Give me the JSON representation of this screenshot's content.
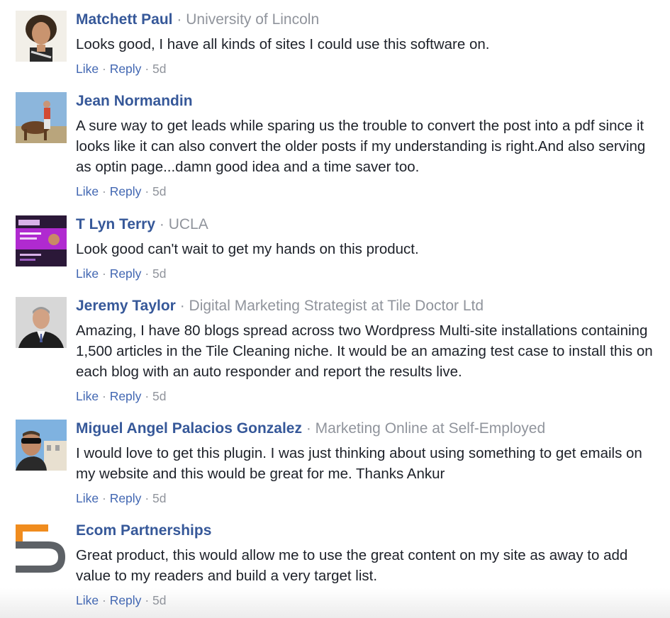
{
  "separator": "·",
  "comments": [
    {
      "author": "Matchett Paul",
      "affiliation": "University of Lincoln",
      "text": "Looks good, I have all kinds of sites I could use this software on.",
      "like": "Like",
      "reply": "Reply",
      "time": "5d"
    },
    {
      "author": "Jean Normandin",
      "affiliation": "",
      "text": "A sure way to get leads while sparing us the trouble to convert the post into a pdf since it looks like it can also convert the older posts if my understanding is right.And also serving as optin page...damn good idea and a time saver too.",
      "like": "Like",
      "reply": "Reply",
      "time": "5d"
    },
    {
      "author": "T Lyn Terry",
      "affiliation": "UCLA",
      "text": "Look good can't wait to get my hands on this product.",
      "like": "Like",
      "reply": "Reply",
      "time": "5d"
    },
    {
      "author": "Jeremy Taylor",
      "affiliation": "Digital Marketing Strategist at Tile Doctor Ltd",
      "text": "Amazing, I have 80 blogs spread across two Wordpress Multi-site installations containing 1,500 articles in the Tile Cleaning niche. It would be an amazing test case to install this on each blog with an auto responder and report the results live.",
      "like": "Like",
      "reply": "Reply",
      "time": "5d"
    },
    {
      "author": "Miguel Angel Palacios Gonzalez",
      "affiliation": "Marketing Online at Self-Employed",
      "text": "I would love to get this plugin. I was just thinking about using something to get emails on my website and this would be great for me. Thanks Ankur",
      "like": "Like",
      "reply": "Reply",
      "time": "5d"
    },
    {
      "author": "Ecom Partnerships",
      "affiliation": "",
      "text": "Great product, this would allow me to use the great content on my site as away to add value to my readers and build a very target list.",
      "like": "Like",
      "reply": "Reply",
      "time": "5d"
    }
  ],
  "colors": {
    "name": "#365899",
    "link": "#4267b2",
    "meta": "#90949c",
    "text": "#1d2129"
  }
}
